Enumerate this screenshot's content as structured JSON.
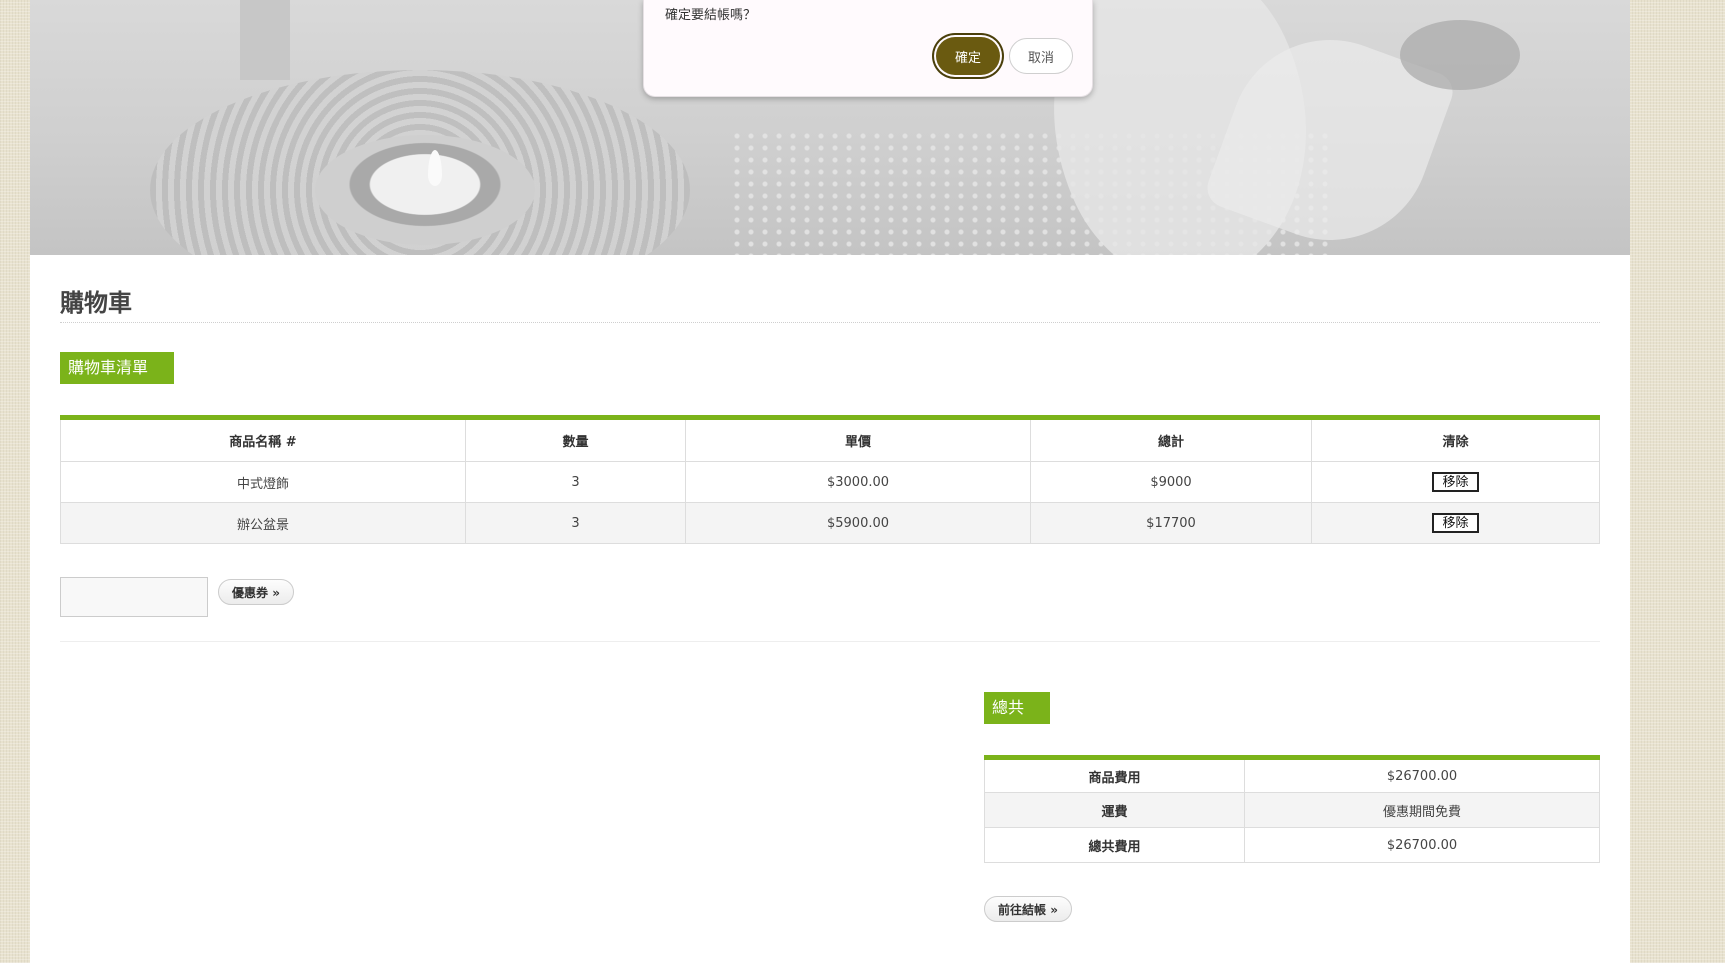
{
  "dialog": {
    "message": "確定要結帳嗎？",
    "confirm_label": "確定",
    "cancel_label": "取消"
  },
  "page": {
    "title": "購物車"
  },
  "cart": {
    "section_label": "購物車清單",
    "headers": [
      "商品名稱 #",
      "數量",
      "單價",
      "總計",
      "清除"
    ],
    "rows": [
      {
        "name": "中式燈飾",
        "qty": "3",
        "unit_price": "$3000.00",
        "total": "$9000",
        "remove": "移除"
      },
      {
        "name": "辦公盆景",
        "qty": "3",
        "unit_price": "$5900.00",
        "total": "$17700",
        "remove": "移除"
      }
    ]
  },
  "coupon": {
    "input_value": "",
    "button_label": "優惠券 »"
  },
  "totals": {
    "section_label": "總共",
    "rows": [
      {
        "label": "商品費用",
        "value": "$26700.00"
      },
      {
        "label": "運費",
        "value": "優惠期間免費"
      },
      {
        "label": "總共費用",
        "value": "$26700.00"
      }
    ],
    "checkout_label": "前往結帳 »"
  },
  "colors": {
    "accent_green": "#7bb31a",
    "confirm_button": "#6a5a10"
  }
}
